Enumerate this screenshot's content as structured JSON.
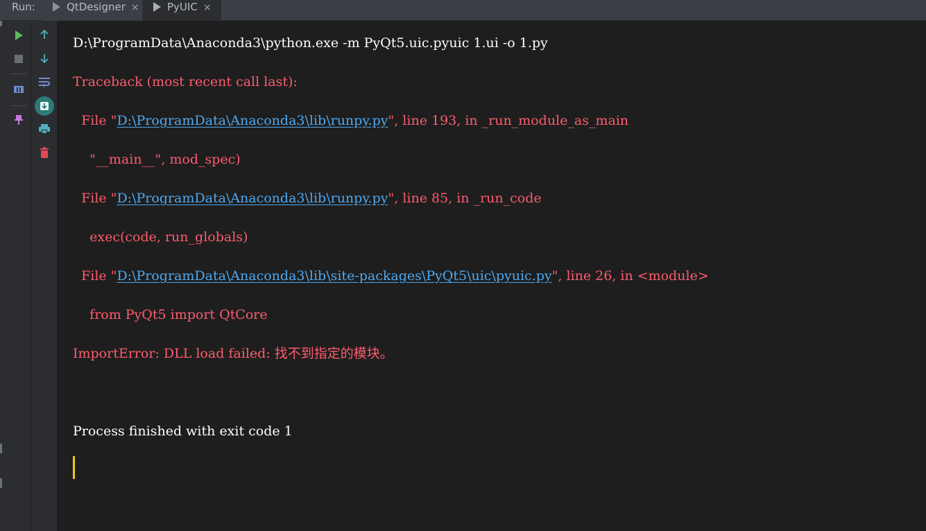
{
  "run_panel": {
    "label": "Run:",
    "tabs": [
      {
        "label": "QtDesigner",
        "active": false
      },
      {
        "label": "PyUIC",
        "active": true
      }
    ],
    "close_glyph": "×"
  },
  "toolbar": {
    "icons": [
      "play-icon",
      "stop-icon",
      "layout-icon",
      "pin-icon",
      "arrow-up-icon",
      "arrow-down-icon",
      "soft-wrap-icon",
      "scroll-to-end-icon",
      "print-icon",
      "trash-icon"
    ]
  },
  "console": {
    "command": "D:\\ProgramData\\Anaconda3\\python.exe -m PyQt5.uic.pyuic 1.ui -o 1.py",
    "traceback_header": "Traceback (most recent call last):",
    "frames": [
      {
        "prefix": "  File \"",
        "path": "D:\\ProgramData\\Anaconda3\\lib\\runpy.py",
        "suffix": "\", line 193, in _run_module_as_main",
        "code": "    \"__main__\", mod_spec)"
      },
      {
        "prefix": "  File \"",
        "path": "D:\\ProgramData\\Anaconda3\\lib\\runpy.py",
        "suffix": "\", line 85, in _run_code",
        "code": "    exec(code, run_globals)"
      },
      {
        "prefix": "  File \"",
        "path": "D:\\ProgramData\\Anaconda3\\lib\\site-packages\\PyQt5\\uic\\pyuic.py",
        "suffix": "\", line 26, in <module>",
        "code": "    from PyQt5 import QtCore"
      }
    ],
    "error": "ImportError: DLL load failed: 找不到指定的模块。",
    "exit_message": "Process finished with exit code 1"
  },
  "colors": {
    "stdout": "#ffffff",
    "stderr": "#ff5b6e",
    "link": "#4fa8f0",
    "caret": "#f5c518"
  }
}
